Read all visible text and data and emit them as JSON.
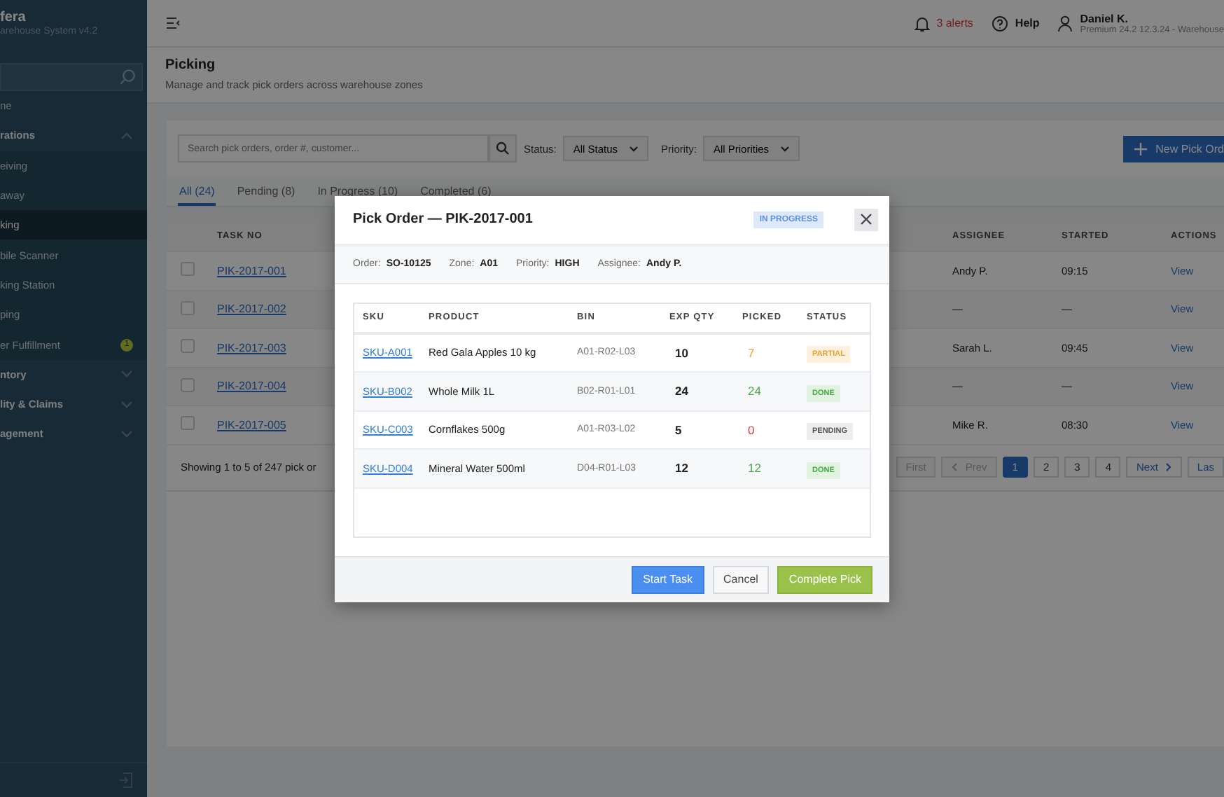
{
  "sidebar": {
    "brand": "fera",
    "subtitle": "arehouse System v4.2",
    "items": [
      {
        "label": "ne",
        "kind": "link",
        "selected": false
      },
      {
        "label": "rations",
        "kind": "group",
        "expanded": true,
        "selected": false,
        "children": [
          {
            "label": "eiving",
            "selected": false
          },
          {
            "label": "away",
            "selected": false
          },
          {
            "label": "king",
            "selected": true
          },
          {
            "label": "bile Scanner",
            "selected": false
          },
          {
            "label": "king Station",
            "selected": false
          },
          {
            "label": "ping",
            "selected": false
          },
          {
            "label": "er Fulfillment",
            "selected": false,
            "badge": "1"
          }
        ]
      },
      {
        "label": "ntory",
        "kind": "group",
        "expanded": false,
        "selected": false
      },
      {
        "label": "lity & Claims",
        "kind": "group",
        "expanded": false,
        "selected": false
      },
      {
        "label": "agement",
        "kind": "group",
        "expanded": false,
        "selected": false
      }
    ]
  },
  "topbar": {
    "alerts": "3 alerts",
    "help": "Help",
    "user_name": "Daniel K.",
    "user_detail": "Premium 24.2 12.3.24 - Warehouse"
  },
  "page": {
    "title": "Picking",
    "subtitle": "Manage and track pick orders across warehouse zones"
  },
  "filters": {
    "search": {
      "placeholder": "Search pick orders, order #, customer..."
    },
    "status_label": "Status:",
    "status_value": "All Status",
    "priority_label": "Priority:",
    "priority_value": "All Priorities",
    "new_button": "New Pick Ord"
  },
  "tabs": [
    {
      "label": "All (24)",
      "selected": true
    },
    {
      "label": "Pending (8)",
      "selected": false
    },
    {
      "label": "In Progress (10)",
      "selected": false
    },
    {
      "label": "Completed (6)",
      "selected": false
    }
  ],
  "table": {
    "columns": [
      "TASK NO",
      "ASSIGNEE",
      "STARTED",
      "ACTIONS"
    ],
    "rows": [
      {
        "checked": false,
        "task_no": "PIK-2017-001",
        "assignee": "Andy P.",
        "started": "09:15",
        "action": "View"
      },
      {
        "checked": false,
        "task_no": "PIK-2017-002",
        "assignee": "—",
        "started": "—",
        "action": "View"
      },
      {
        "checked": false,
        "task_no": "PIK-2017-003",
        "assignee": "Sarah L.",
        "started": "09:45",
        "action": "View"
      },
      {
        "checked": false,
        "task_no": "PIK-2017-004",
        "assignee": "—",
        "started": "—",
        "action": "View"
      },
      {
        "checked": false,
        "task_no": "PIK-2017-005",
        "assignee": "Mike R.",
        "started": "08:30",
        "action": "View"
      }
    ],
    "summary": "Showing 1 to 5 of 247 pick or",
    "pagination": [
      {
        "label": "First",
        "kind": "nav",
        "disabled": true,
        "selected": false
      },
      {
        "label": "Prev",
        "kind": "prev",
        "disabled": true,
        "selected": false
      },
      {
        "label": "1",
        "kind": "page",
        "disabled": false,
        "selected": true
      },
      {
        "label": "2",
        "kind": "page",
        "disabled": false,
        "selected": false
      },
      {
        "label": "3",
        "kind": "page",
        "disabled": false,
        "selected": false
      },
      {
        "label": "4",
        "kind": "page",
        "disabled": false,
        "selected": false
      },
      {
        "label": "Next",
        "kind": "next",
        "disabled": false,
        "selected": false
      },
      {
        "label": "Las",
        "kind": "nav",
        "disabled": false,
        "selected": false
      }
    ]
  },
  "modal": {
    "title": "Pick Order — PIK-2017-001",
    "status": "IN PROGRESS",
    "meta": [
      {
        "label": "Order:",
        "value": "SO-10125"
      },
      {
        "label": "Zone:",
        "value": "A01"
      },
      {
        "label": "Priority:",
        "value": "HIGH"
      },
      {
        "label": "Assignee:",
        "value": "Andy P."
      }
    ],
    "columns": [
      "SKU",
      "PRODUCT",
      "BIN",
      "EXP QTY",
      "PICKED",
      "STATUS"
    ],
    "rows": [
      {
        "sku": "SKU-A001",
        "product": "Red Gala Apples 10 kg",
        "bin": "A01-R02-L03",
        "exp_qty": "10",
        "picked": "7",
        "status": "PARTIAL",
        "kind": "partial"
      },
      {
        "sku": "SKU-B002",
        "product": "Whole Milk 1L",
        "bin": "B02-R01-L01",
        "exp_qty": "24",
        "picked": "24",
        "status": "DONE",
        "kind": "done"
      },
      {
        "sku": "SKU-C003",
        "product": "Cornflakes 500g",
        "bin": "A01-R03-L02",
        "exp_qty": "5",
        "picked": "0",
        "status": "PENDING",
        "kind": "pending"
      },
      {
        "sku": "SKU-D004",
        "product": "Mineral Water 500ml",
        "bin": "D04-R01-L03",
        "exp_qty": "12",
        "picked": "12",
        "status": "DONE",
        "kind": "done"
      }
    ],
    "buttons": [
      {
        "label": "Start Task",
        "kind": "primary"
      },
      {
        "label": "Cancel",
        "kind": "secondary"
      },
      {
        "label": "Complete Pick",
        "kind": "success"
      }
    ]
  }
}
